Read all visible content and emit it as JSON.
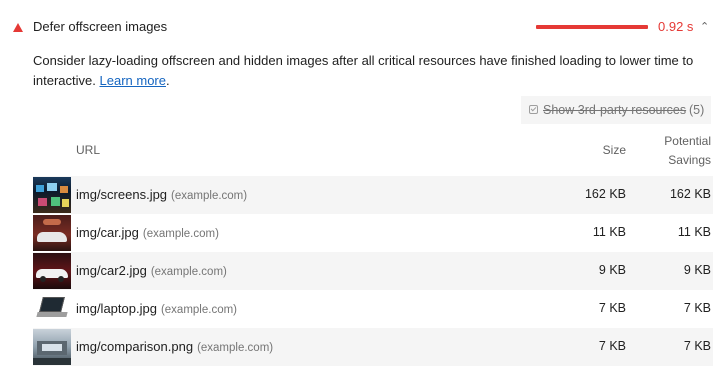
{
  "audit": {
    "title": "Defer offscreen images",
    "savings": "0.92 s",
    "status_color": "#e53935",
    "chevron_icon": "chevron-up-icon",
    "description_text": "Consider lazy-loading offscreen and hidden images after all critical resources have finished loading to lower time to interactive.",
    "learn_more": "Learn more",
    "learn_more_suffix": "."
  },
  "filter": {
    "label": "Show 3rd-party resources",
    "count": "(5)"
  },
  "table": {
    "headers": {
      "url": "URL",
      "size": "Size",
      "savings_line1": "Potential",
      "savings_line2": "Savings"
    },
    "rows": [
      {
        "url": "img/screens.jpg",
        "origin": "(example.com)",
        "size": "162 KB",
        "savings": "162 KB"
      },
      {
        "url": "img/car.jpg",
        "origin": "(example.com)",
        "size": "11 KB",
        "savings": "11 KB"
      },
      {
        "url": "img/car2.jpg",
        "origin": "(example.com)",
        "size": "9 KB",
        "savings": "9 KB"
      },
      {
        "url": "img/laptop.jpg",
        "origin": "(example.com)",
        "size": "7 KB",
        "savings": "7 KB"
      },
      {
        "url": "img/comparison.png",
        "origin": "(example.com)",
        "size": "7 KB",
        "savings": "7 KB"
      }
    ]
  }
}
